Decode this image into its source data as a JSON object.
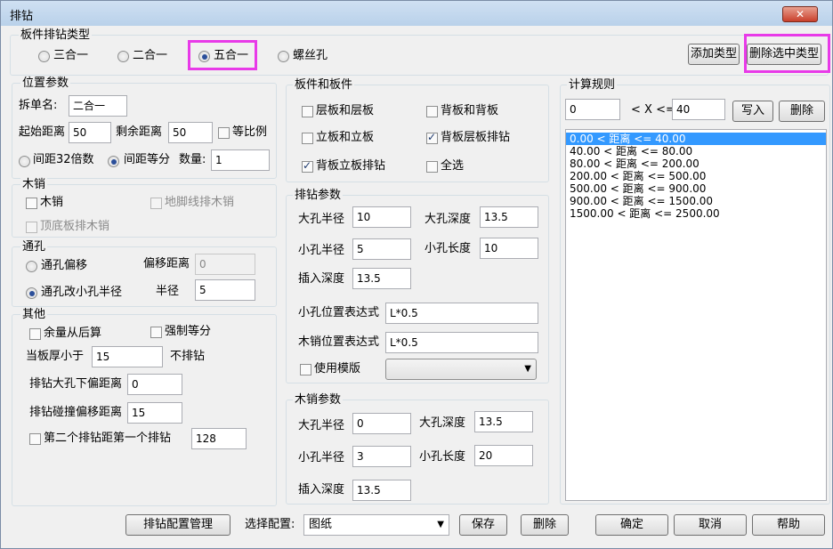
{
  "window": {
    "title": "排钻",
    "close_label": "✕"
  },
  "board_type": {
    "group_label": "板件排钻类型",
    "options": [
      "三合一",
      "二合一",
      "五合一",
      "螺丝孔"
    ],
    "add_type": "添加类型",
    "delete_type": "删除选中类型"
  },
  "position": {
    "group_label": "位置参数",
    "split_name_label": "拆单名:",
    "split_name_value": "二合一",
    "start_dist_label": "起始距离",
    "start_dist_value": "50",
    "remain_dist_label": "剩余距离",
    "remain_dist_value": "50",
    "equal_ratio_label": "等比例",
    "spacing32_label": "间距32倍数",
    "spacing_equal_label": "间距等分",
    "count_label": "数量:",
    "count_value": "1"
  },
  "dowel": {
    "group_label": "木销",
    "dowel_label": "木销",
    "foot_line_label": "地脚线排木销",
    "top_bottom_label": "顶底板排木销"
  },
  "through": {
    "group_label": "通孔",
    "offset_label": "通孔偏移",
    "offset_dist_label": "偏移距离",
    "offset_dist_value": "0",
    "change_small_label": "通孔改小孔半径",
    "radius_label": "半径",
    "radius_value": "5"
  },
  "other": {
    "group_label": "其他",
    "from_back_label": "余量从后算",
    "force_equal_label": "强制等分",
    "thickness_label": "当板厚小于",
    "thickness_value": "15",
    "no_drill_label": "不排钻",
    "big_offset_label": "排钻大孔下偏距离",
    "big_offset_value": "0",
    "collision_label": "排钻碰撞偏移距离",
    "collision_value": "15",
    "second_label": "第二个排钻距第一个排钻",
    "second_value": "128"
  },
  "boards": {
    "group_label": "板件和板件",
    "layer_layer": "层板和层板",
    "back_back": "背板和背板",
    "vertical_vertical": "立板和立板",
    "back_layer": "背板层板排钻",
    "back_vertical": "背板立板排钻",
    "select_all": "全选"
  },
  "drill": {
    "group_label": "排钻参数",
    "big_radius_label": "大孔半径",
    "big_radius_value": "10",
    "big_depth_label": "大孔深度",
    "big_depth_value": "13.5",
    "small_radius_label": "小孔半径",
    "small_radius_value": "5",
    "small_length_label": "小孔长度",
    "small_length_value": "10",
    "insert_depth_label": "插入深度",
    "insert_depth_value": "13.5",
    "small_expr_label": "小孔位置表达式",
    "small_expr_value": "L*0.5",
    "dowel_expr_label": "木销位置表达式",
    "dowel_expr_value": "L*0.5",
    "use_template_label": "使用模版"
  },
  "dowel_params": {
    "group_label": "木销参数",
    "big_radius_label": "大孔半径",
    "big_radius_value": "0",
    "big_depth_label": "大孔深度",
    "big_depth_value": "13.5",
    "small_radius_label": "小孔半径",
    "small_radius_value": "3",
    "small_length_label": "小孔长度",
    "small_length_value": "20",
    "insert_depth_label": "插入深度",
    "insert_depth_value": "13.5"
  },
  "rules": {
    "group_label": "计算规则",
    "from_value": "0",
    "op_label": "< X <=",
    "to_value": "40",
    "write_label": "写入",
    "delete_label": "删除",
    "items": [
      "0.00 < 距离 <= 40.00",
      "40.00 < 距离 <= 80.00",
      "80.00 < 距离 <= 200.00",
      "200.00 < 距离 <= 500.00",
      "500.00 < 距离 <= 900.00",
      "900.00 < 距离 <= 1500.00",
      "1500.00 < 距离 <= 2500.00"
    ]
  },
  "footer": {
    "config_manage": "排钻配置管理",
    "select_config_label": "选择配置:",
    "config_value": "图纸",
    "save": "保存",
    "delete": "删除",
    "ok": "确定",
    "cancel": "取消",
    "help": "帮助"
  },
  "colors": {
    "highlight": "#e83ae8",
    "selection": "#3399ff"
  }
}
